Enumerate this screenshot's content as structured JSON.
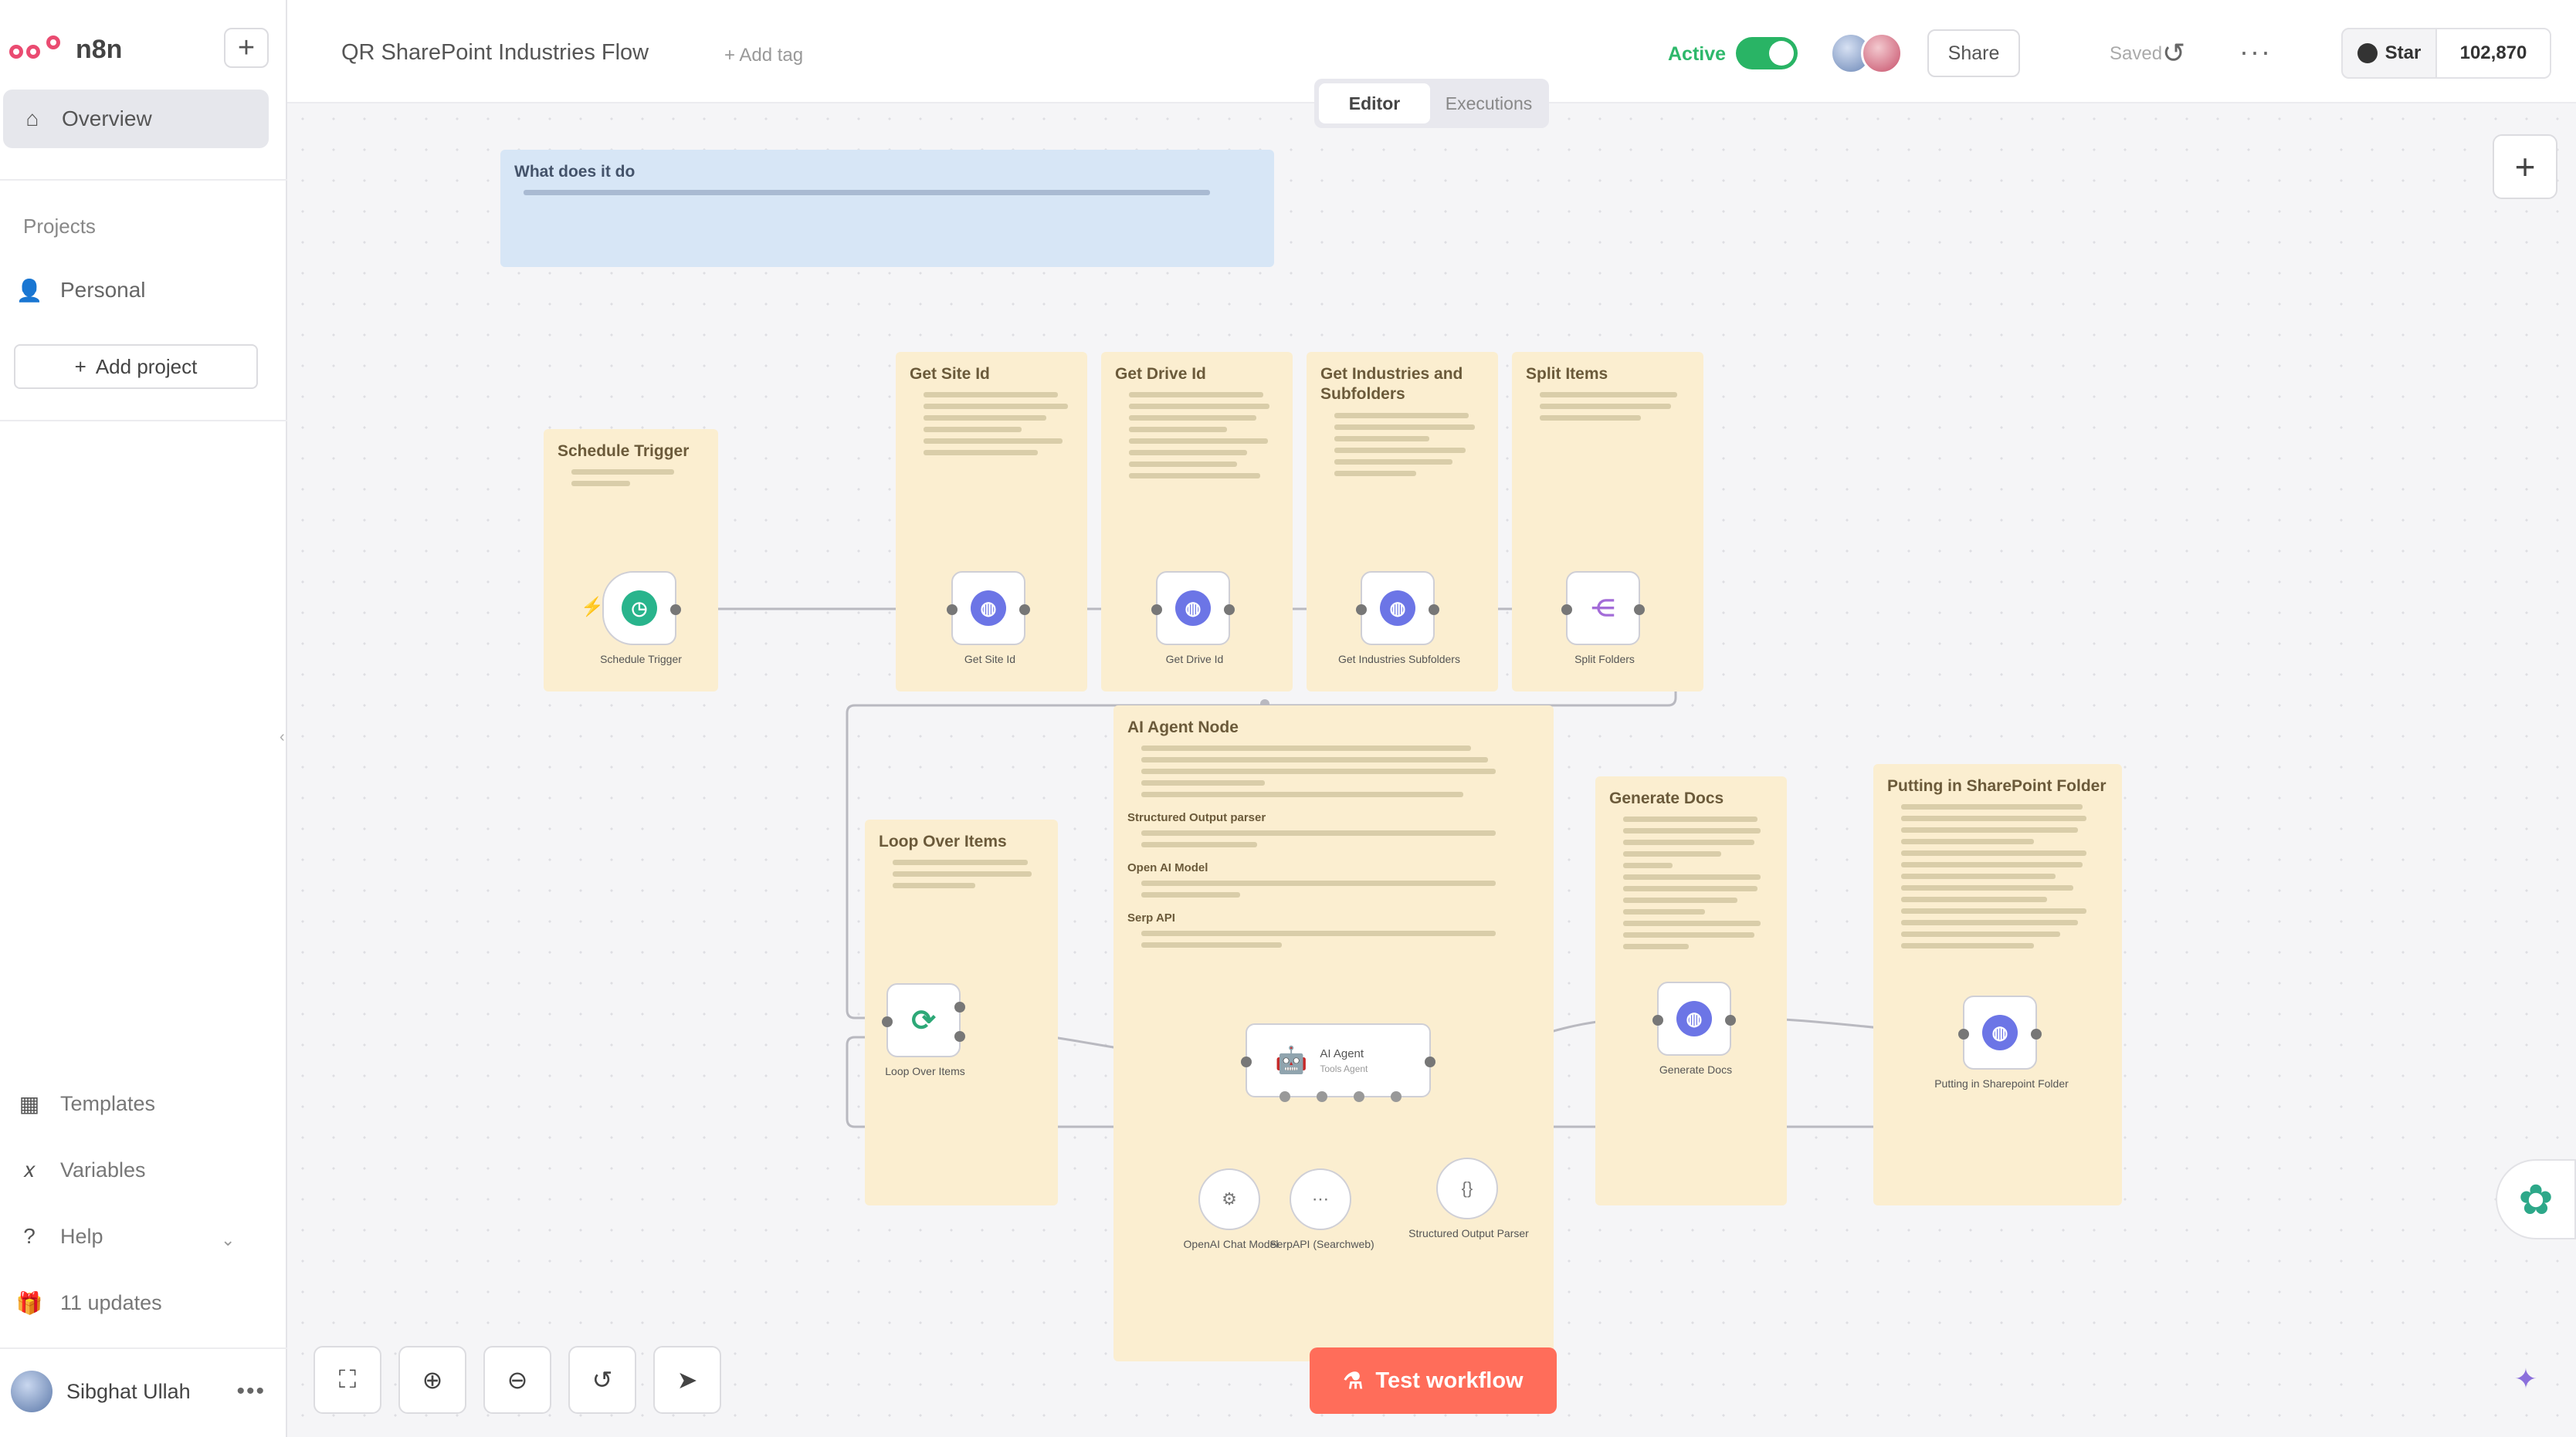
{
  "app": {
    "brand": "n8n",
    "accent": "#ea4b71",
    "canvas_bg": "#f5f5f7"
  },
  "sidebar": {
    "overview": "Overview",
    "projects_label": "Projects",
    "personal": "Personal",
    "add_project": "Add project",
    "templates": "Templates",
    "variables": "Variables",
    "help": "Help",
    "updates": "11 updates",
    "user_name": "Sibghat Ullah"
  },
  "header": {
    "workflow_title": "QR SharePoint Industries Flow",
    "add_tag": "+ Add tag",
    "active_label": "Active",
    "active_color": "#29b465",
    "share_label": "Share",
    "saved_label": "Saved",
    "github_star": "Star",
    "github_count": "102,870"
  },
  "tabs": {
    "editor": "Editor",
    "executions": "Executions"
  },
  "canvas": {
    "stickies": {
      "what_title": "What does it do",
      "schedule": "Schedule Trigger",
      "site_id": "Get Site Id",
      "drive_id": "Get Drive Id",
      "industries": "Get Industries and Subfolders",
      "split": "Split Items",
      "ai_agent": "AI Agent Node",
      "ai_struct": "Structured Output parser",
      "ai_openai": "Open AI Model",
      "ai_serp": "Serp API",
      "loop": "Loop Over Items",
      "generate": "Generate Docs",
      "putting": "Putting in SharePoint Folder"
    },
    "nodes": {
      "schedule": "Schedule Trigger",
      "site_id": "Get Site Id",
      "drive_id": "Get Drive Id",
      "industries": "Get Industries Subfolders",
      "split": "Split Folders",
      "loop": "Loop Over Items",
      "agent": "AI Agent",
      "agent_sub": "Tools Agent",
      "openai": "OpenAI Chat Model",
      "serp": "SerpAPI (Searchweb)",
      "parser": "Structured Output Parser",
      "generate": "Generate Docs",
      "putting": "Putting in Sharepoint Folder"
    }
  },
  "footer": {
    "test_workflow": "Test workflow"
  }
}
